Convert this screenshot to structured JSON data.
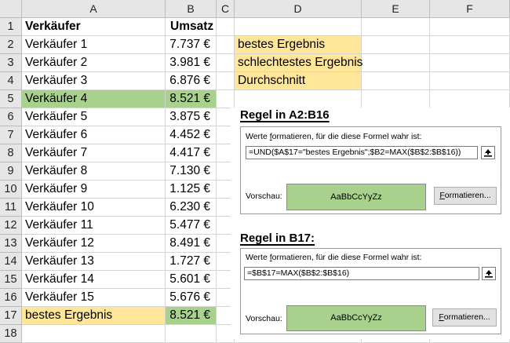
{
  "columns": [
    "A",
    "B",
    "C",
    "D",
    "E",
    "F"
  ],
  "rows": [
    "1",
    "2",
    "3",
    "4",
    "5",
    "6",
    "7",
    "8",
    "9",
    "10",
    "11",
    "12",
    "13",
    "14",
    "15",
    "16",
    "17",
    "18"
  ],
  "header": {
    "a1": "Verkäufer",
    "b1": "Umsatz"
  },
  "sellers": [
    {
      "name": "Verkäufer 1",
      "sales": "7.737 €"
    },
    {
      "name": "Verkäufer 2",
      "sales": "3.981 €"
    },
    {
      "name": "Verkäufer 3",
      "sales": "6.876 €"
    },
    {
      "name": "Verkäufer 4",
      "sales": "8.521 €"
    },
    {
      "name": "Verkäufer 5",
      "sales": "3.875 €"
    },
    {
      "name": "Verkäufer 6",
      "sales": "4.452 €"
    },
    {
      "name": "Verkäufer 7",
      "sales": "4.417 €"
    },
    {
      "name": "Verkäufer 8",
      "sales": "7.130 €"
    },
    {
      "name": "Verkäufer 9",
      "sales": "1.125 €"
    },
    {
      "name": "Verkäufer 10",
      "sales": "6.230 €"
    },
    {
      "name": "Verkäufer 11",
      "sales": "5.477 €"
    },
    {
      "name": "Verkäufer 12",
      "sales": "8.491 €"
    },
    {
      "name": "Verkäufer 13",
      "sales": "1.727 €"
    },
    {
      "name": "Verkäufer 14",
      "sales": "5.601 €"
    },
    {
      "name": "Verkäufer 15",
      "sales": "5.676 €"
    }
  ],
  "row17": {
    "a": "bestes Ergebnis",
    "b": "8.521 €"
  },
  "options": [
    "bestes Ergebnis",
    "schlechtestes Ergebnis",
    "Durchschnitt"
  ],
  "colors": {
    "highlight_green": "#a9d18e",
    "highlight_orange": "#ffe699"
  },
  "rule1": {
    "title": "Regel in A2:B16",
    "label_pre": "Werte ",
    "label_u": "f",
    "label_post": "ormatieren, für die diese Formel wahr ist:",
    "formula": "=UND($A$17=\"bestes Ergebnis\";$B2=MAX($B$2:$B$16))",
    "preview_label": "Vorschau:",
    "preview_text": "AaBbCcYyZz",
    "button_u": "F",
    "button_rest": "ormatieren..."
  },
  "rule2": {
    "title": "Regel in B17:",
    "label_pre": "Werte ",
    "label_u": "f",
    "label_post": "ormatieren, für die diese Formel wahr ist:",
    "formula": "=$B$17=MAX($B$2:$B$16)",
    "preview_label": "Vorschau:",
    "preview_text": "AaBbCcYyZz",
    "button_u": "F",
    "button_rest": "ormatieren..."
  },
  "icons": {
    "collapse": "collapse-dialog-icon"
  }
}
